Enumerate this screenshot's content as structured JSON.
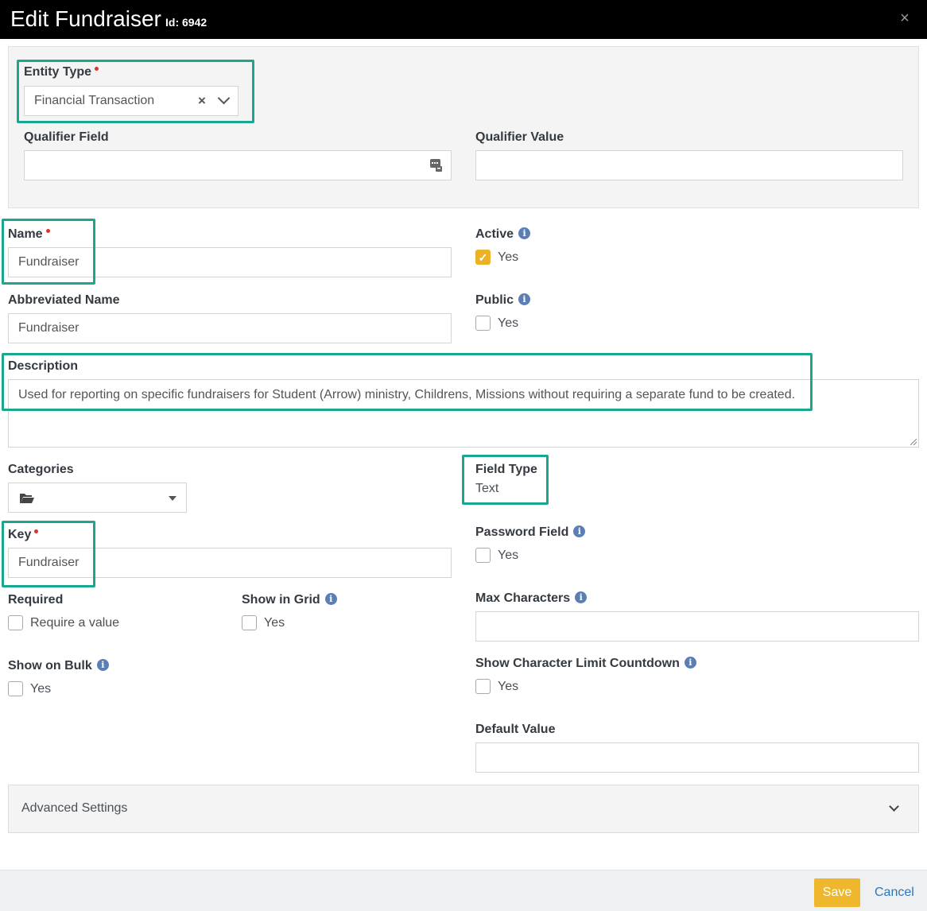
{
  "header": {
    "title": "Edit Fundraiser",
    "id_label": "Id: 6942",
    "close_icon": "×"
  },
  "entity_type": {
    "label": "Entity Type",
    "value": "Financial Transaction",
    "clear_icon": "×"
  },
  "qualifier_field": {
    "label": "Qualifier Field",
    "value": ""
  },
  "qualifier_value": {
    "label": "Qualifier Value",
    "value": ""
  },
  "name": {
    "label": "Name",
    "value": "Fundraiser"
  },
  "active": {
    "label": "Active",
    "checkbox_label": "Yes",
    "checked": true,
    "info_icon": "i"
  },
  "abbreviated_name": {
    "label": "Abbreviated Name",
    "value": "Fundraiser"
  },
  "public": {
    "label": "Public",
    "checkbox_label": "Yes",
    "checked": false,
    "info_icon": "i"
  },
  "description": {
    "label": "Description",
    "value": "Used for reporting on specific fundraisers for Student (Arrow) ministry, Childrens, Missions without requiring a separate fund to be created."
  },
  "categories": {
    "label": "Categories",
    "icon": "folder-open-icon"
  },
  "field_type": {
    "label": "Field Type",
    "value": "Text"
  },
  "key": {
    "label": "Key",
    "value": "Fundraiser"
  },
  "password_field": {
    "label": "Password Field",
    "checkbox_label": "Yes",
    "checked": false,
    "info_icon": "i"
  },
  "required": {
    "label": "Required",
    "checkbox_label": "Require a value",
    "checked": false
  },
  "show_in_grid": {
    "label": "Show in Grid",
    "checkbox_label": "Yes",
    "checked": false,
    "info_icon": "i"
  },
  "max_characters": {
    "label": "Max Characters",
    "value": "",
    "info_icon": "i"
  },
  "show_on_bulk": {
    "label": "Show on Bulk",
    "checkbox_label": "Yes",
    "checked": false,
    "info_icon": "i"
  },
  "show_char_limit": {
    "label": "Show Character Limit Countdown",
    "checkbox_label": "Yes",
    "checked": false,
    "info_icon": "i"
  },
  "default_value": {
    "label": "Default Value",
    "value": ""
  },
  "advanced": {
    "label": "Advanced Settings"
  },
  "footer": {
    "save_label": "Save",
    "cancel_label": "Cancel"
  },
  "colors": {
    "header_bg": "#000000",
    "highlight": "#1aa68f",
    "save_button": "#efb72b",
    "link": "#2f76b7",
    "required_dot": "#d9352d",
    "info_icon": "#5b7fb4"
  }
}
